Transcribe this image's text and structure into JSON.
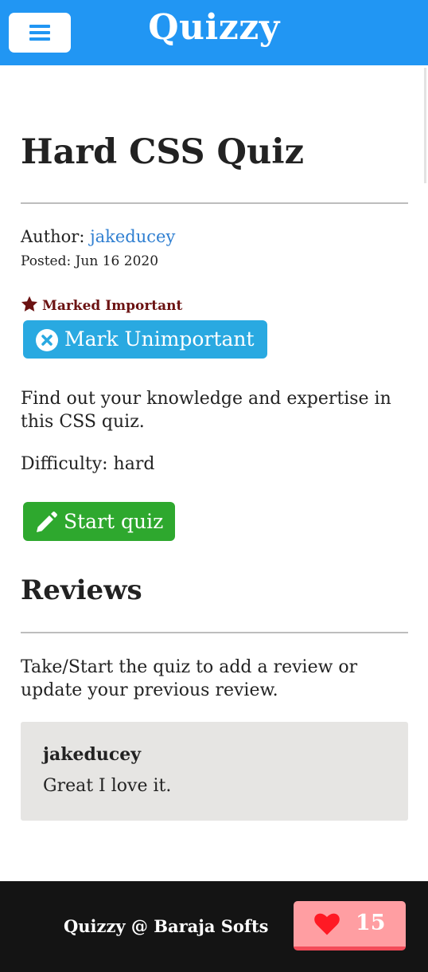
{
  "header": {
    "brand": "Quizzy",
    "menu_icon": "hamburger-icon"
  },
  "quiz": {
    "title": "Hard CSS Quiz",
    "author_label": "Author:",
    "author_name": "jakeducey",
    "posted": "Posted: Jun 16 2020",
    "important_label": "Marked Important",
    "unimportant_button": "Mark Unimportant",
    "description": "Find out your knowledge and expertise in this CSS quiz.",
    "difficulty": "Difficulty: hard",
    "start_button": "Start quiz"
  },
  "reviews": {
    "title": "Reviews",
    "note": "Take/Start the quiz to add a review or update your previous review.",
    "items": [
      {
        "user": "jakeducey",
        "text": "Great I love it."
      }
    ]
  },
  "footer": {
    "text": "Quizzy @ Baraja Softs",
    "likes": "15"
  },
  "colors": {
    "header": "#2196f3",
    "link": "#2f7fd1",
    "important": "#6b1212",
    "unimportant_button": "#29a9e1",
    "start_button": "#2ea82e",
    "like_button": "#ff9ea2",
    "footer": "#141414"
  }
}
